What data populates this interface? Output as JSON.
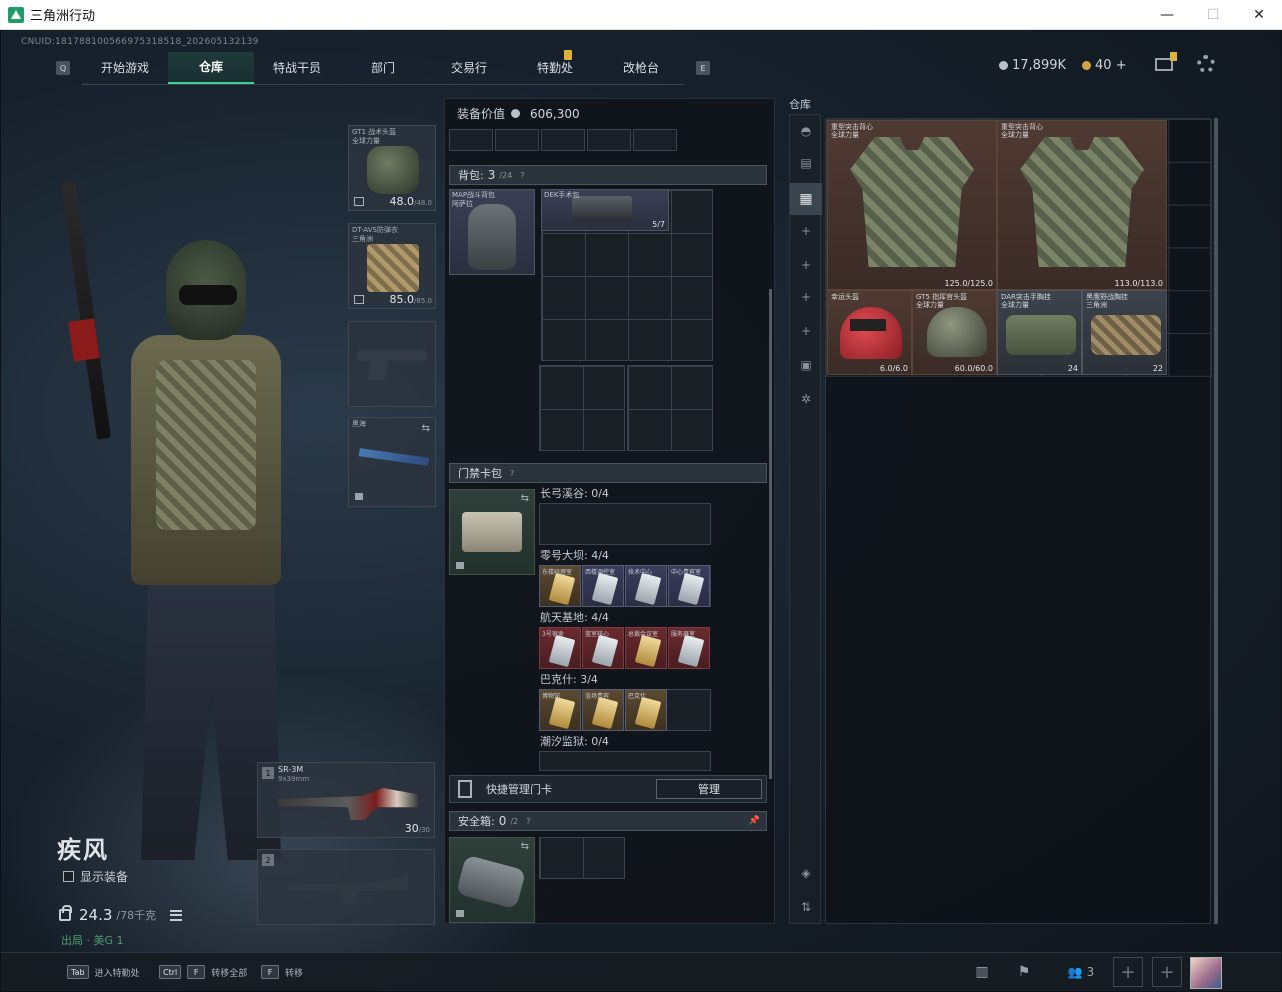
{
  "window": {
    "title": "三角洲行动",
    "minimize": "—",
    "maximize": "☐",
    "close": "✕"
  },
  "uid": "CNUID:181788100566975318518_202605132139",
  "nav": {
    "key_left": "Q",
    "key_right": "E",
    "tabs": [
      {
        "label": "开始游戏"
      },
      {
        "label": "仓库"
      },
      {
        "label": "特战干员"
      },
      {
        "label": "部门"
      },
      {
        "label": "交易行"
      },
      {
        "label": "特勤处"
      },
      {
        "label": "改枪台"
      }
    ],
    "active_tab": "仓库"
  },
  "currency": {
    "silver": "17,899K",
    "gold": "40",
    "gold_add": "+"
  },
  "operator": {
    "name": "疾风",
    "show_gear_label": "显示装备",
    "weight": "24.3",
    "weight_max": "/78千克",
    "status": "出局 · 美G 1"
  },
  "gear_slots": {
    "helmet": {
      "name": "GT1 战术头盔\n全球力量",
      "durability": "48.0",
      "max": "/48.0"
    },
    "armor": {
      "name": "DT-AVS防弹衣\n三角洲",
      "durability": "85.0",
      "max": "/85.0"
    },
    "melee": {
      "name": "黑海"
    }
  },
  "weapons": {
    "primary": {
      "slot": "1",
      "name": "SR-3M",
      "caliber": "9x39mm",
      "ammo": "30",
      "ammo_max": "/30"
    },
    "secondary": {
      "slot": "2"
    }
  },
  "equipment": {
    "value_label": "装备价值",
    "value": "606,300",
    "backpack_label": "背包:",
    "backpack_used": "3",
    "backpack_total": "/24",
    "backpack_item": "MAP战斗背包\n阿萨拉",
    "case_item": "DEK手术包",
    "case_count": "5/7",
    "keycard_label": "门禁卡包",
    "zones": [
      {
        "label": "长弓溪谷: 0/4",
        "cards": []
      },
      {
        "label": "零号大坝: 4/4",
        "cards": [
          {
            "name": "东楼经理室",
            "tone": "gold"
          },
          {
            "name": "西楼调控室"
          },
          {
            "name": "技术中心"
          },
          {
            "name": "中心贵宾室"
          }
        ]
      },
      {
        "label": "航天基地: 4/4",
        "cards": [
          {
            "name": "3号宿舍"
          },
          {
            "name": "蓝室核心"
          },
          {
            "name": "总裁会议室",
            "tone": "gold"
          },
          {
            "name": "服务器室"
          }
        ]
      },
      {
        "label": "巴克什: 3/4",
        "cards": [
          {
            "name": "博物馆",
            "tone": "gold"
          },
          {
            "name": "浴场贵宾"
          },
          {
            "name": "巴克什"
          }
        ]
      },
      {
        "label": "潮汐监狱: 0/4",
        "cards": []
      }
    ],
    "quick_manage_label": "快捷管理门卡",
    "manage_button": "管理",
    "safebox_label": "安全箱:",
    "safebox_used": "0",
    "safebox_total": "/2",
    "help": "?",
    "pin": "📌"
  },
  "warehouse": {
    "label": "仓库",
    "items": [
      {
        "name": "重型突击背心\n全球力量",
        "durability": "125.0/125.0"
      },
      {
        "name": "重型突击背心\n全球力量",
        "durability": "113.0/113.0"
      },
      {
        "name": "幸运头盔",
        "durability": "6.0/6.0"
      },
      {
        "name": "GT5 指挥官头盔\n全球力量",
        "durability": "60.0/60.0"
      },
      {
        "name": "DAR突击手胸挂\n全球力量",
        "durability": "24"
      },
      {
        "name": "黑鹰野战胸挂\n三角洲",
        "durability": "22"
      }
    ]
  },
  "bottom_bar": {
    "hints": [
      {
        "key": "Tab",
        "label": "进入特勤处"
      },
      {
        "key": "Ctrl",
        "key2": "F",
        "label": "转移全部"
      },
      {
        "key": "F",
        "label": "转移"
      }
    ],
    "squad_count": "3",
    "add": "+"
  }
}
